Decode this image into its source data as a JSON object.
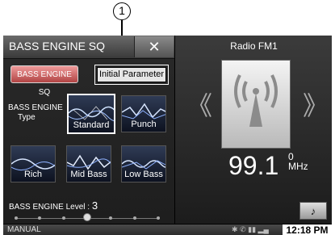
{
  "callout": "1",
  "panel": {
    "title": "BASS ENGINE SQ",
    "tabs": [
      {
        "label": "BASS ENGINE SQ"
      },
      {
        "label": "Initial Parameter"
      }
    ],
    "type_label_line1": "BASS ENGINE",
    "type_label_line2": "Type",
    "presets": [
      {
        "label": "Standard",
        "selected": true
      },
      {
        "label": "Punch"
      },
      {
        "label": "Rich"
      },
      {
        "label": "Mid Bass"
      },
      {
        "label": "Low Bass"
      }
    ],
    "level_label": "BASS ENGINE Level : ",
    "level_value": "3",
    "level_steps": 7
  },
  "radio": {
    "title": "Radio FM1",
    "frequency": "99.1",
    "unit_top": "0",
    "unit": "MHz"
  },
  "status": {
    "mode": "MANUAL",
    "time": "12:18 PM"
  },
  "icons": {
    "close": "close-icon",
    "note": "music-note-icon",
    "prev": "chevron-left-icon",
    "next": "chevron-right-icon",
    "album": "radio-antenna-icon"
  },
  "colors": {
    "active_tab": "#d96b6b",
    "background": "#1d1d1d"
  }
}
